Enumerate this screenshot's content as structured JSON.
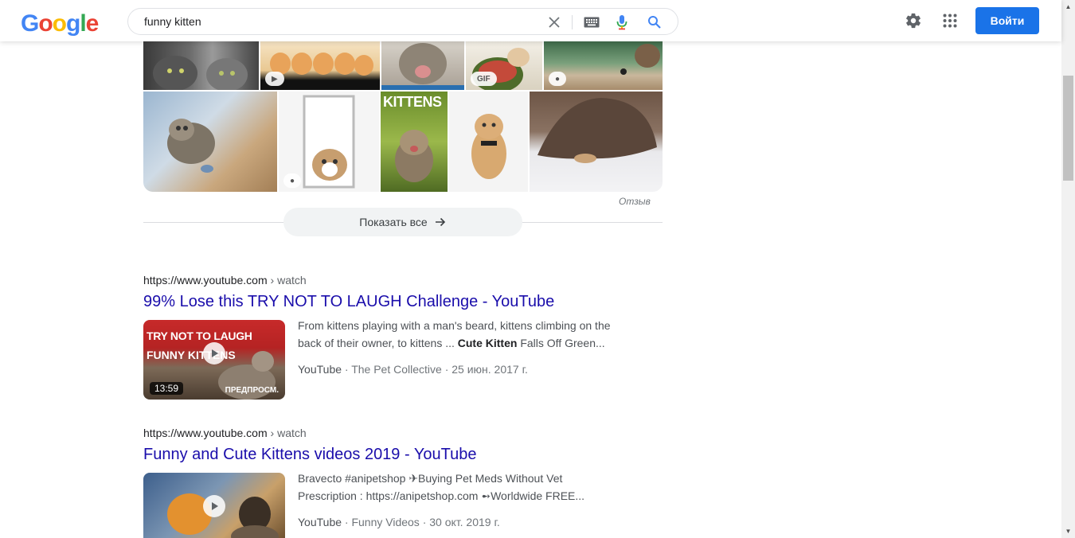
{
  "header": {
    "logo_letters": [
      {
        "ch": "G",
        "color": "#4285F4"
      },
      {
        "ch": "o",
        "color": "#EA4335"
      },
      {
        "ch": "o",
        "color": "#FBBC05"
      },
      {
        "ch": "g",
        "color": "#4285F4"
      },
      {
        "ch": "l",
        "color": "#34A853"
      },
      {
        "ch": "e",
        "color": "#EA4335"
      }
    ],
    "search_value": "funny kitten",
    "signin_label": "Войти"
  },
  "images": {
    "badges": {
      "video": "▶",
      "gif": "GIF",
      "tag": "●"
    },
    "kittens_cover_text": "KITTENS",
    "feedback_label": "Отзыв",
    "show_all_label": "Показать все"
  },
  "results": [
    {
      "url": "https://www.youtube.com",
      "crumb": " › watch",
      "title": "99% Lose this TRY NOT TO LAUGH Challenge - YouTube",
      "snippet_pre": "From kittens playing with a man's beard, kittens climbing on the back of their owner, to kittens ... ",
      "snippet_bold": "Cute Kitten",
      "snippet_post": " Falls Off Green...",
      "source": "YouTube",
      "meta": " · The Pet Collective · 25 июн. 2017 г.",
      "duration": "13:59",
      "preview_label": "ПРЕДПРОСМ.",
      "thumb_text_1": "TRY NOT TO LAUGH",
      "thumb_text_2": "FUNNY KITTENS"
    },
    {
      "url": "https://www.youtube.com",
      "crumb": " › watch",
      "title": "Funny and Cute Kittens videos 2019 - YouTube",
      "snippet_pre": "Bravecto #anipetshop ✈Buying Pet Meds Without Vet Prescription : https://anipetshop.com ➻Worldwide FREE...",
      "snippet_bold": "",
      "snippet_post": "",
      "source": "YouTube",
      "meta": " · Funny Videos · 30 окт. 2019 г."
    }
  ]
}
